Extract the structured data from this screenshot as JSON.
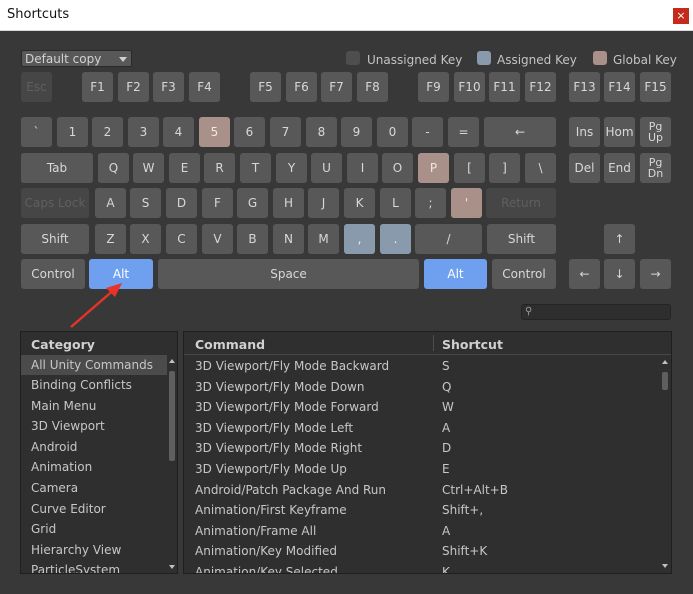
{
  "window": {
    "title": "Shortcuts",
    "close_label": "×"
  },
  "profile": {
    "selected": "Default copy"
  },
  "legend": [
    {
      "label": "Unassigned Key",
      "color": "#4e4e4e"
    },
    {
      "label": "Assigned Key",
      "color": "#8a9aad"
    },
    {
      "label": "Global Key",
      "color": "#a99189"
    }
  ],
  "keys": {
    "esc": "Esc",
    "f1": "F1",
    "f2": "F2",
    "f3": "F3",
    "f4": "F4",
    "f5": "F5",
    "f6": "F6",
    "f7": "F7",
    "f8": "F8",
    "f9": "F9",
    "f10": "F10",
    "f11": "F11",
    "f12": "F12",
    "f13": "F13",
    "f14": "F14",
    "f15": "F15",
    "backquote": "`",
    "d1": "1",
    "d2": "2",
    "d3": "3",
    "d4": "4",
    "d5": "5",
    "d6": "6",
    "d7": "7",
    "d8": "8",
    "d9": "9",
    "d0": "0",
    "minus": "-",
    "equals": "=",
    "backspace": "←",
    "ins": "Ins",
    "home": "Hom",
    "pgup_1": "Pg",
    "pgup_2": "Up",
    "tab": "Tab",
    "q": "Q",
    "w": "W",
    "e": "E",
    "r": "R",
    "t": "T",
    "y": "Y",
    "u": "U",
    "i": "I",
    "o": "O",
    "p": "P",
    "lbracket": "[",
    "rbracket": "]",
    "backslash": "\\",
    "del": "Del",
    "end": "End",
    "pgdn_1": "Pg",
    "pgdn_2": "Dn",
    "capslock": "Caps Lock",
    "a": "A",
    "s": "S",
    "d": "D",
    "f": "F",
    "g": "G",
    "h": "H",
    "j": "J",
    "k": "K",
    "l": "L",
    "semicolon": ";",
    "quote": "'",
    "return": "Return",
    "lshift": "Shift",
    "z": "Z",
    "x": "X",
    "c": "C",
    "v": "V",
    "b": "B",
    "n": "N",
    "m": "M",
    "comma": ",",
    "period": ".",
    "slash": "/",
    "rshift": "Shift",
    "up": "↑",
    "lcontrol": "Control",
    "lalt": "Alt",
    "space": "Space",
    "ralt": "Alt",
    "rcontrol": "Control",
    "left": "←",
    "down": "↓",
    "right": "→"
  },
  "search": {
    "icon": "search-icon",
    "value": ""
  },
  "categories": {
    "header": "Category",
    "items": [
      "All Unity Commands",
      "Binding Conflicts",
      "Main Menu",
      "3D Viewport",
      "Android",
      "Animation",
      "Camera",
      "Curve Editor",
      "Grid",
      "Hierarchy View",
      "ParticleSystem"
    ],
    "selected_index": 0
  },
  "commands": {
    "header_command": "Command",
    "header_shortcut": "Shortcut",
    "rows": [
      {
        "command": "3D Viewport/Fly Mode Backward",
        "shortcut": "S"
      },
      {
        "command": "3D Viewport/Fly Mode Down",
        "shortcut": "Q"
      },
      {
        "command": "3D Viewport/Fly Mode Forward",
        "shortcut": "W"
      },
      {
        "command": "3D Viewport/Fly Mode Left",
        "shortcut": "A"
      },
      {
        "command": "3D Viewport/Fly Mode Right",
        "shortcut": "D"
      },
      {
        "command": "3D Viewport/Fly Mode Up",
        "shortcut": "E"
      },
      {
        "command": "Android/Patch Package And Run",
        "shortcut": "Ctrl+Alt+B"
      },
      {
        "command": "Animation/First Keyframe",
        "shortcut": "Shift+,"
      },
      {
        "command": "Animation/Frame All",
        "shortcut": "A"
      },
      {
        "command": "Animation/Key Modified",
        "shortcut": "Shift+K"
      },
      {
        "command": "Animation/Key Selected",
        "shortcut": "K"
      }
    ]
  }
}
